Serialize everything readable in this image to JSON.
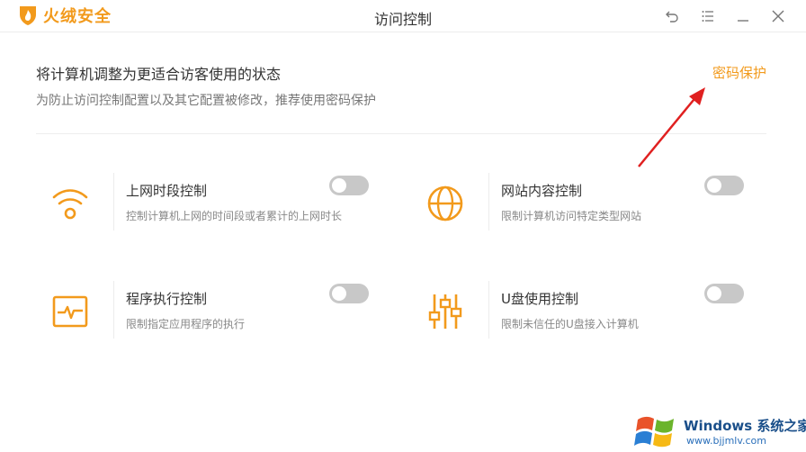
{
  "app": {
    "brand_name": "火绒安全",
    "window_title": "访问控制"
  },
  "header": {
    "title": "将计算机调整为更适合访客使用的状态",
    "subtitle": "为防止访问控制配置以及其它配置被修改，推荐使用密码保护",
    "password_link": "密码保护"
  },
  "cards": [
    {
      "title": "上网时段控制",
      "desc": "控制计算机上网的时间段或者累计的上网时长",
      "icon": "wifi-icon",
      "enabled": false
    },
    {
      "title": "网站内容控制",
      "desc": "限制计算机访问特定类型网站",
      "icon": "globe-icon",
      "enabled": false
    },
    {
      "title": "程序执行控制",
      "desc": "限制指定应用程序的执行",
      "icon": "program-monitor-icon",
      "enabled": false
    },
    {
      "title": "U盘使用控制",
      "desc": "限制未信任的U盘接入计算机",
      "icon": "sliders-icon",
      "enabled": false
    }
  ],
  "watermark": {
    "brand": "Windows 系统之家",
    "url": "www.bjjmlv.com"
  },
  "colors": {
    "accent": "#f29a1c",
    "toggle_off": "#c8c8c8",
    "arrow": "#e02020"
  }
}
